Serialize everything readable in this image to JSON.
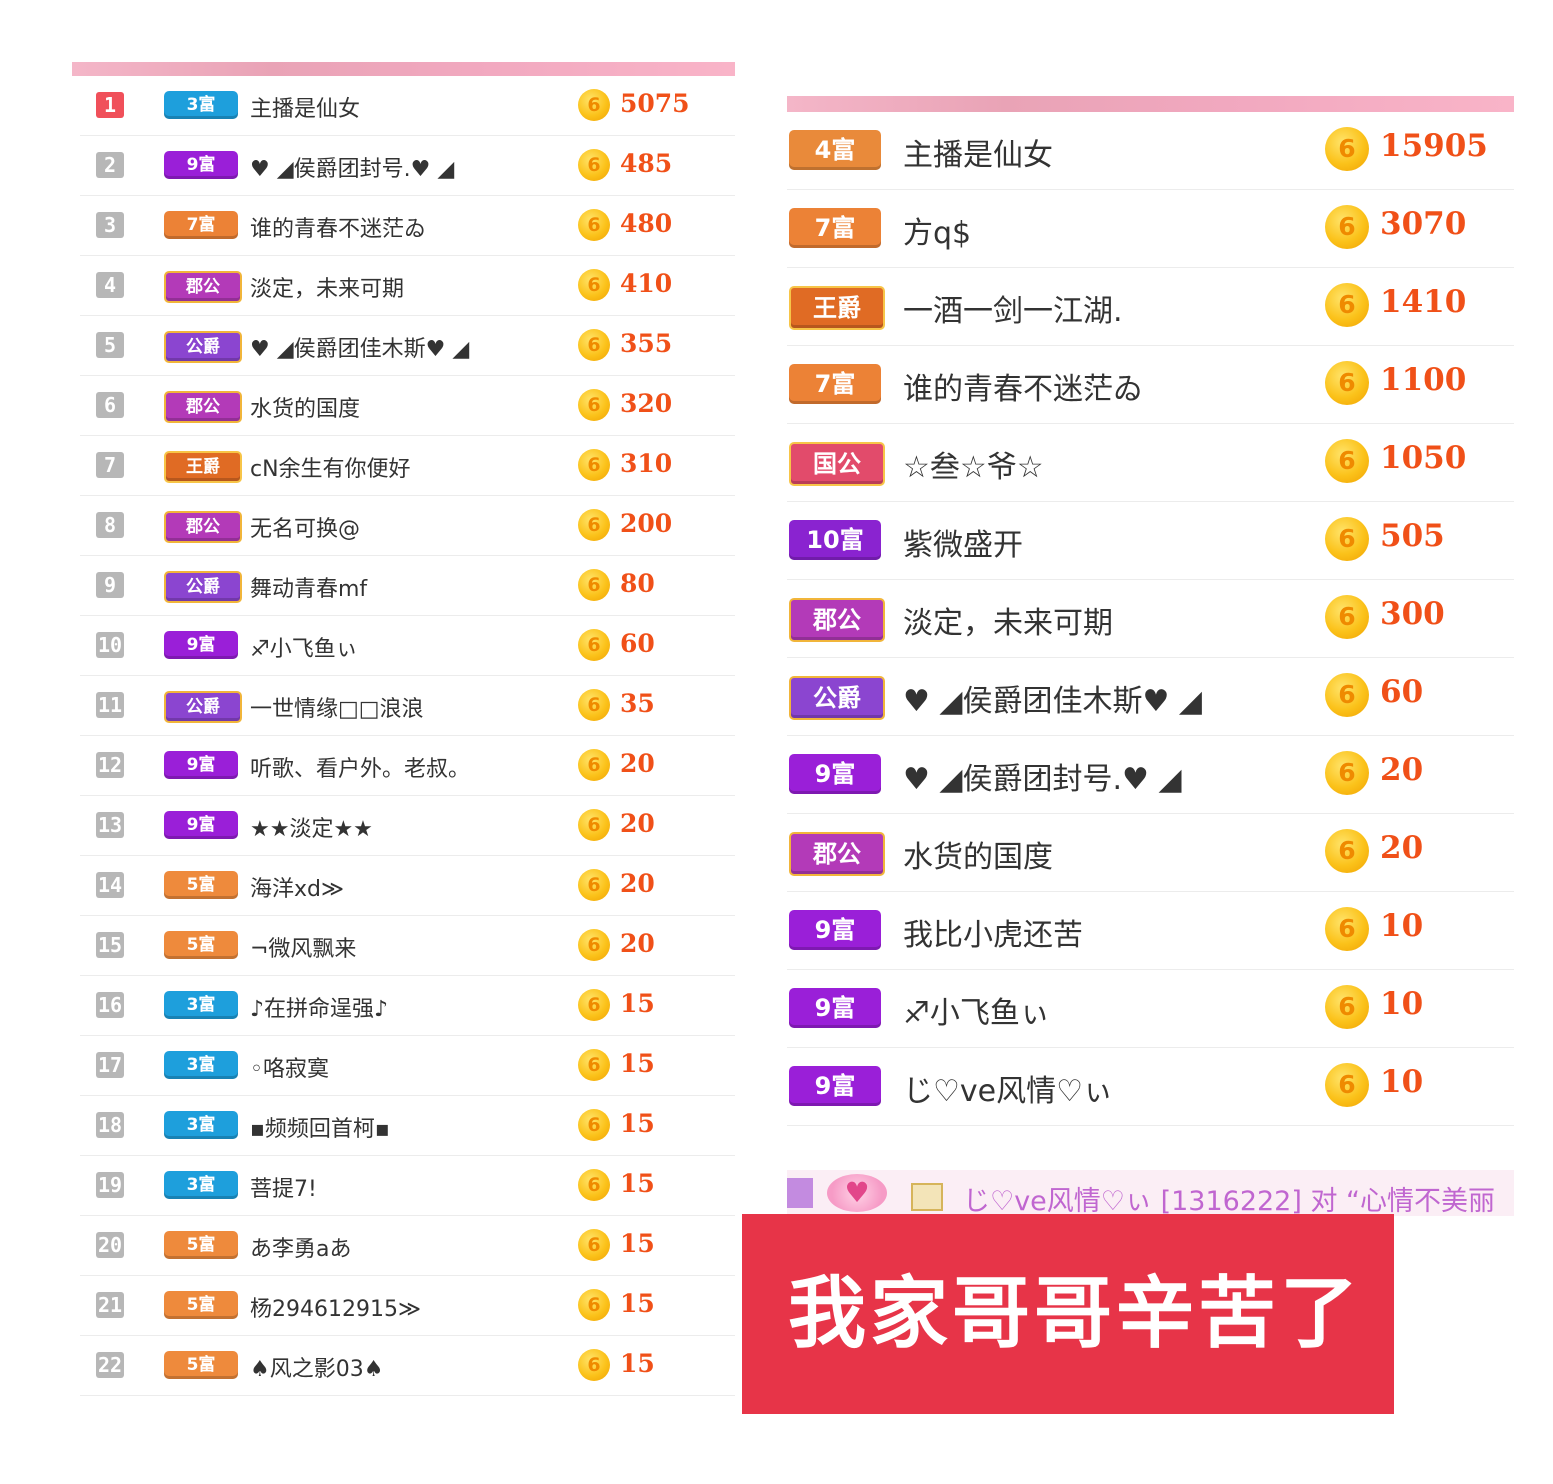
{
  "left_panel": {
    "rows": [
      {
        "rank": "1",
        "badge": "3富",
        "badge_class": "b-fu3",
        "name": "主播是仙女",
        "coin": "6",
        "amount": "5075"
      },
      {
        "rank": "2",
        "badge": "9富",
        "badge_class": "b-fu9",
        "name": "♥ ◢侯爵团封号.♥ ◢",
        "coin": "6",
        "amount": "485"
      },
      {
        "rank": "3",
        "badge": "7富",
        "badge_class": "b-fu7",
        "name": "谁的青春不迷茫ゐ",
        "coin": "6",
        "amount": "480"
      },
      {
        "rank": "4",
        "badge": "郡公",
        "badge_class": "b-dugong",
        "name": "淡定，未来可期",
        "coin": "6",
        "amount": "410"
      },
      {
        "rank": "5",
        "badge": "公爵",
        "badge_class": "b-gongjue",
        "name": "♥ ◢侯爵团佳木斯♥ ◢",
        "coin": "6",
        "amount": "355"
      },
      {
        "rank": "6",
        "badge": "郡公",
        "badge_class": "b-dugong",
        "name": "水货的国度",
        "coin": "6",
        "amount": "320"
      },
      {
        "rank": "7",
        "badge": "王爵",
        "badge_class": "b-wangjue",
        "name": "cN余生有你便好",
        "coin": "6",
        "amount": "310"
      },
      {
        "rank": "8",
        "badge": "郡公",
        "badge_class": "b-dugong",
        "name": "无名可换@",
        "coin": "6",
        "amount": "200"
      },
      {
        "rank": "9",
        "badge": "公爵",
        "badge_class": "b-gongjue",
        "name": "舞动青春mf",
        "coin": "6",
        "amount": "80"
      },
      {
        "rank": "10",
        "badge": "9富",
        "badge_class": "b-fu9",
        "name": "♐小飞鱼ぃ",
        "coin": "6",
        "amount": "60"
      },
      {
        "rank": "11",
        "badge": "公爵",
        "badge_class": "b-gongjue",
        "name": "一世情缘□□浪浪",
        "coin": "6",
        "amount": "35"
      },
      {
        "rank": "12",
        "badge": "9富",
        "badge_class": "b-fu9",
        "name": "听歌、看户外。老叔。",
        "coin": "6",
        "amount": "20"
      },
      {
        "rank": "13",
        "badge": "9富",
        "badge_class": "b-fu9",
        "name": "★★淡定★★",
        "coin": "6",
        "amount": "20"
      },
      {
        "rank": "14",
        "badge": "5富",
        "badge_class": "b-fu5",
        "name": "海洋xd≫",
        "coin": "6",
        "amount": "20"
      },
      {
        "rank": "15",
        "badge": "5富",
        "badge_class": "b-fu5",
        "name": "¬微风飘来",
        "coin": "6",
        "amount": "20"
      },
      {
        "rank": "16",
        "badge": "3富",
        "badge_class": "b-fu3",
        "name": "♪在拼命逞强♪",
        "coin": "6",
        "amount": "15"
      },
      {
        "rank": "17",
        "badge": "3富",
        "badge_class": "b-fu3",
        "name": "◦咯寂寞",
        "coin": "6",
        "amount": "15"
      },
      {
        "rank": "18",
        "badge": "3富",
        "badge_class": "b-fu3",
        "name": "▪频频回首柯▪",
        "coin": "6",
        "amount": "15"
      },
      {
        "rank": "19",
        "badge": "3富",
        "badge_class": "b-fu3",
        "name": "菩提7!",
        "coin": "6",
        "amount": "15"
      },
      {
        "rank": "20",
        "badge": "5富",
        "badge_class": "b-fu5",
        "name": "あ李勇aあ",
        "coin": "6",
        "amount": "15"
      },
      {
        "rank": "21",
        "badge": "5富",
        "badge_class": "b-fu5",
        "name": "杨294612915≫",
        "coin": "6",
        "amount": "15"
      },
      {
        "rank": "22",
        "badge": "5富",
        "badge_class": "b-fu5",
        "name": "♠风之影03♠",
        "coin": "6",
        "amount": "15"
      }
    ]
  },
  "right_panel": {
    "rows": [
      {
        "badge": "4富",
        "badge_class": "b-fu4",
        "name": "主播是仙女",
        "coin": "6",
        "amount": "15905"
      },
      {
        "badge": "7富",
        "badge_class": "b-fu7",
        "name": "方q$",
        "coin": "6",
        "amount": "3070"
      },
      {
        "badge": "王爵",
        "badge_class": "b-wangjue",
        "name": "一酒一剑一江湖.",
        "coin": "6",
        "amount": "1410"
      },
      {
        "badge": "7富",
        "badge_class": "b-fu7",
        "name": "谁的青春不迷茫ゐ",
        "coin": "6",
        "amount": "1100"
      },
      {
        "badge": "国公",
        "badge_class": "b-guogong",
        "name": "☆叁☆爷☆",
        "coin": "6",
        "amount": "1050"
      },
      {
        "badge": "10富",
        "badge_class": "b-fu10",
        "name": "紫微盛开",
        "coin": "6",
        "amount": "505"
      },
      {
        "badge": "郡公",
        "badge_class": "b-dugong",
        "name": "淡定，未来可期",
        "coin": "6",
        "amount": "300"
      },
      {
        "badge": "公爵",
        "badge_class": "b-gongjue",
        "name": "♥ ◢侯爵团佳木斯♥ ◢",
        "coin": "6",
        "amount": "60"
      },
      {
        "badge": "9富",
        "badge_class": "b-fu9",
        "name": "♥ ◢侯爵团封号.♥ ◢",
        "coin": "6",
        "amount": "20"
      },
      {
        "badge": "郡公",
        "badge_class": "b-dugong",
        "name": "水货的国度",
        "coin": "6",
        "amount": "20"
      },
      {
        "badge": "9富",
        "badge_class": "b-fu9",
        "name": "我比小虎还苦",
        "coin": "6",
        "amount": "10"
      },
      {
        "badge": "9富",
        "badge_class": "b-fu9",
        "name": "♐小飞鱼ぃ",
        "coin": "6",
        "amount": "10"
      },
      {
        "badge": "9富",
        "badge_class": "b-fu9",
        "name": "じ♡ve风情♡ぃ",
        "coin": "6",
        "amount": "10"
      }
    ]
  },
  "chat_strip": {
    "text": "じ♡ve风情♡ぃ [1316222] 对 “心情不美丽",
    "heart_icon": "heart-icon",
    "user_icon": "user-icon"
  },
  "caption": {
    "text": "我家哥哥辛苦了"
  },
  "colors": {
    "accent_pink": "#f4b6c8",
    "amount_orange": "#f05018",
    "caption_red": "#e73448"
  }
}
